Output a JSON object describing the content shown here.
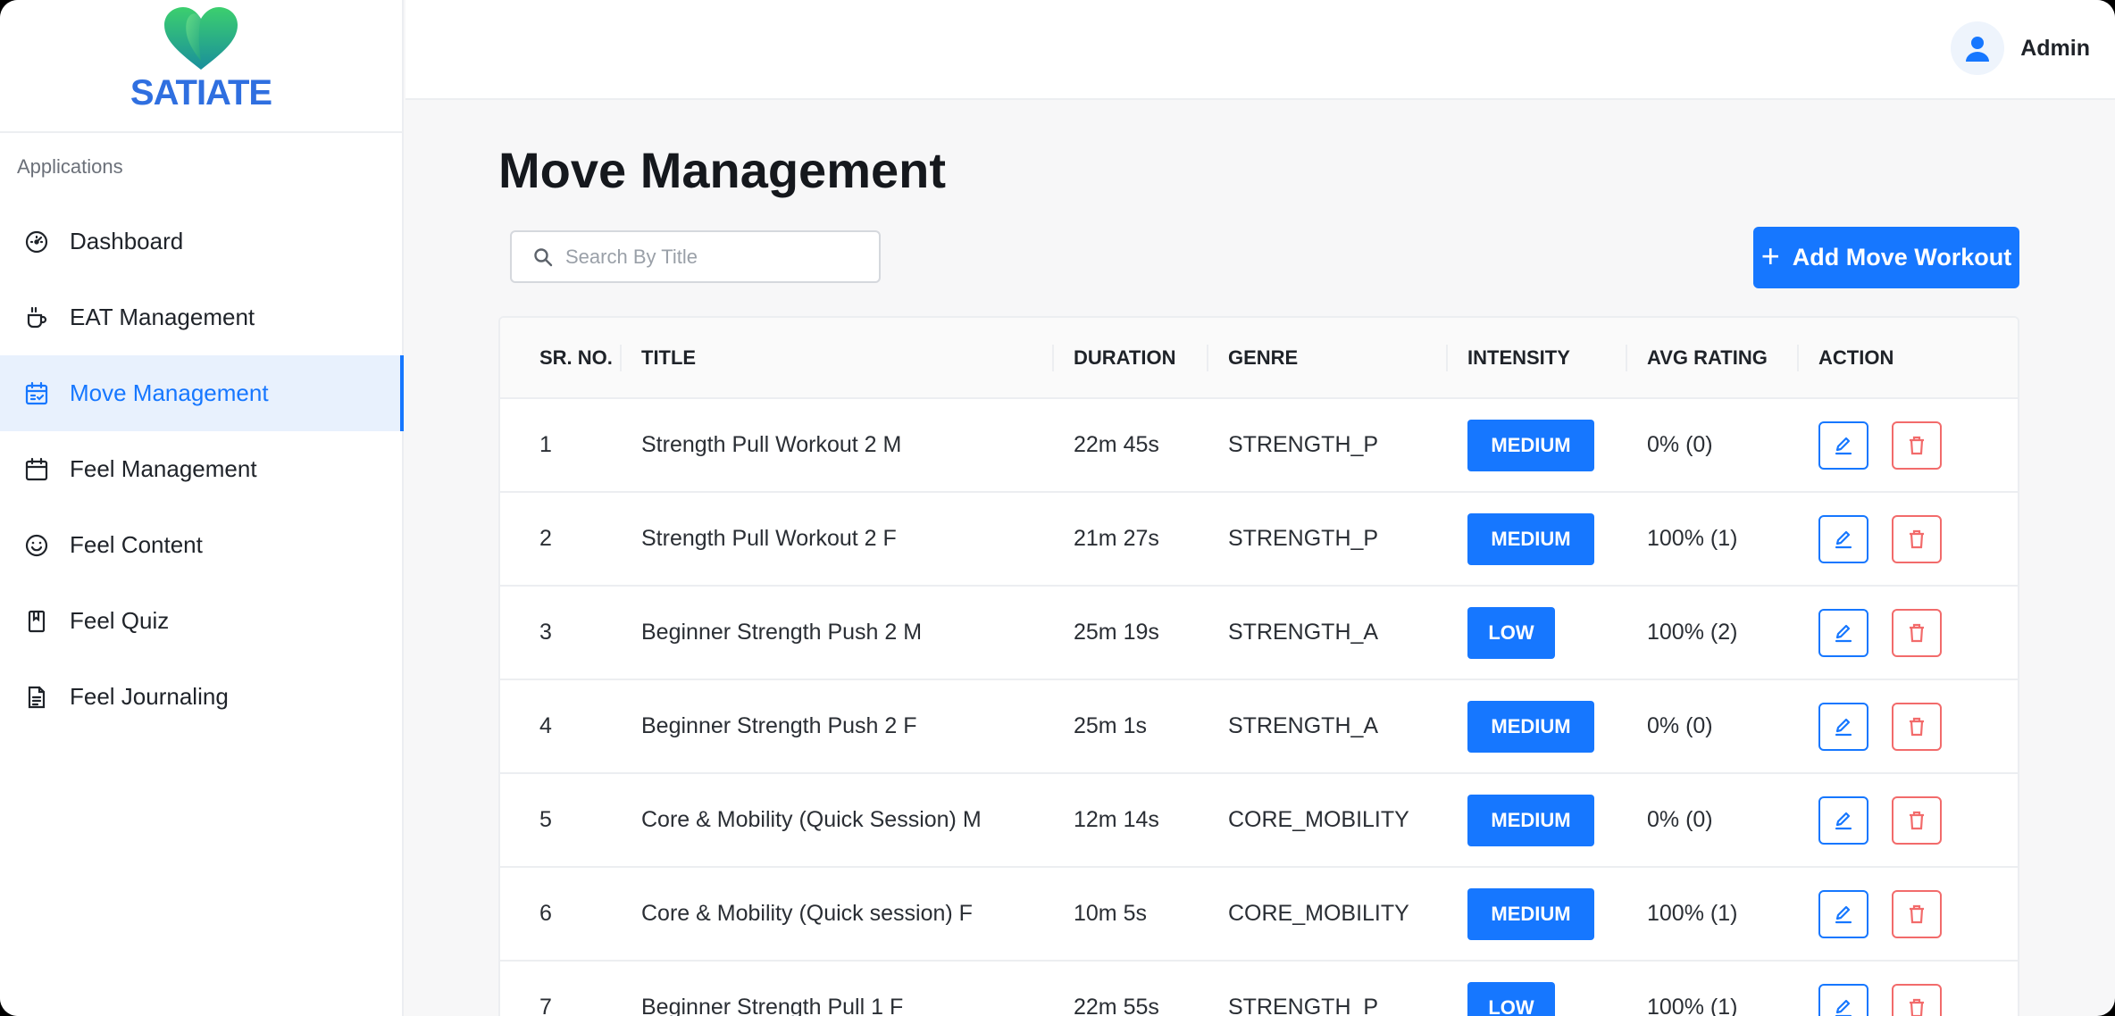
{
  "brand": {
    "name": "SATIATE"
  },
  "sidebar": {
    "section_label": "Applications",
    "items": [
      {
        "label": "Dashboard",
        "icon": "gauge-icon",
        "active": false
      },
      {
        "label": "EAT Management",
        "icon": "coffee-cup-icon",
        "active": false
      },
      {
        "label": "Move Management",
        "icon": "calendar-check-icon",
        "active": true
      },
      {
        "label": "Feel Management",
        "icon": "calendar-icon",
        "active": false
      },
      {
        "label": "Feel Content",
        "icon": "smile-icon",
        "active": false
      },
      {
        "label": "Feel Quiz",
        "icon": "bookmark-icon",
        "active": false
      },
      {
        "label": "Feel Journaling",
        "icon": "document-icon",
        "active": false
      }
    ]
  },
  "header": {
    "user_name": "Admin"
  },
  "main": {
    "title": "Move Management",
    "search_placeholder": "Search By Title",
    "add_button_label": "Add Move Workout",
    "columns": [
      "SR. NO.",
      "TITLE",
      "DURATION",
      "GENRE",
      "INTENSITY",
      "AVG RATING",
      "ACTION"
    ],
    "rows": [
      {
        "sr": "1",
        "title": "Strength Pull Workout 2 M",
        "duration": "22m 45s",
        "genre": "STRENGTH_P",
        "intensity": "MEDIUM",
        "rating": "0% (0)"
      },
      {
        "sr": "2",
        "title": "Strength Pull Workout 2 F",
        "duration": "21m 27s",
        "genre": "STRENGTH_P",
        "intensity": "MEDIUM",
        "rating": "100% (1)"
      },
      {
        "sr": "3",
        "title": "Beginner Strength Push 2 M",
        "duration": "25m 19s",
        "genre": "STRENGTH_A",
        "intensity": "LOW",
        "rating": "100% (2)"
      },
      {
        "sr": "4",
        "title": "Beginner Strength Push 2 F",
        "duration": "25m 1s",
        "genre": "STRENGTH_A",
        "intensity": "MEDIUM",
        "rating": "0% (0)"
      },
      {
        "sr": "5",
        "title": "Core & Mobility (Quick Session) M",
        "duration": "12m 14s",
        "genre": "CORE_MOBILITY",
        "intensity": "MEDIUM",
        "rating": "0% (0)"
      },
      {
        "sr": "6",
        "title": "Core & Mobility (Quick session) F",
        "duration": "10m 5s",
        "genre": "CORE_MOBILITY",
        "intensity": "MEDIUM",
        "rating": "100% (1)"
      },
      {
        "sr": "7",
        "title": "Beginner Strength Pull 1 F",
        "duration": "22m 55s",
        "genre": "STRENGTH_P",
        "intensity": "LOW",
        "rating": "100% (1)"
      }
    ]
  },
  "colors": {
    "accent": "#1677ff",
    "active_bg": "#e8f1fd",
    "delete": "#f26b6b",
    "brand_text": "#2f6fe0",
    "logo_green": "#2dbf78",
    "logo_teal": "#1f9aa0"
  }
}
